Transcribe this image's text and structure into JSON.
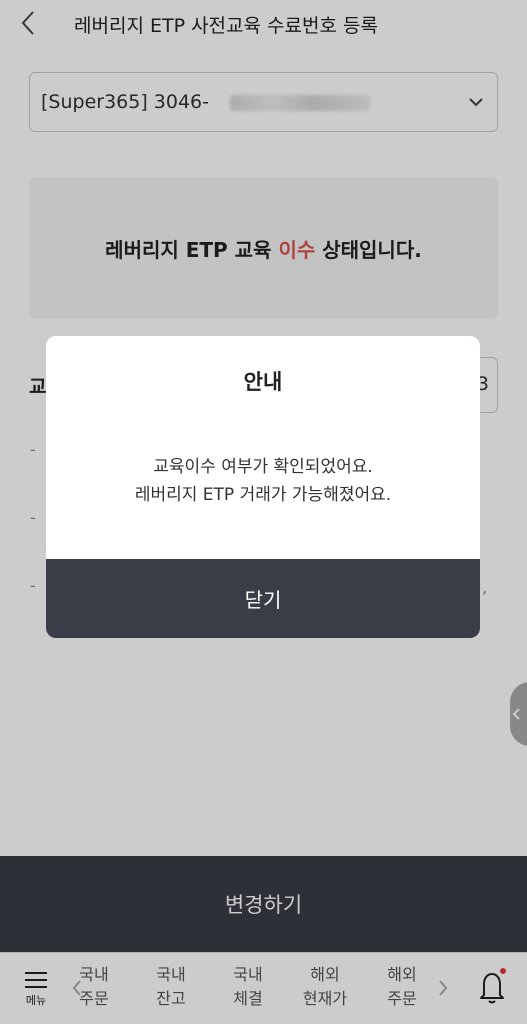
{
  "header": {
    "title": "레버리지 ETP 사전교육 수료번호 등록"
  },
  "account_select": {
    "value": "[Super365] 3046-"
  },
  "status": {
    "prefix": "레버리지 ETP 교육 ",
    "highlight": "이수",
    "suffix": " 상태입니다."
  },
  "background_field": {
    "label": "교",
    "value_tail": "3"
  },
  "dialog": {
    "title": "안내",
    "message_line1": "교육이수 여부가 확인되었어요.",
    "message_line2": "레버리지 ETP 거래가 가능해졌어요.",
    "close_label": "닫기"
  },
  "primary_button": {
    "label": "변경하기"
  },
  "bottom_nav": {
    "menu_label": "메뉴",
    "items": [
      {
        "label": "국내\n주문"
      },
      {
        "label": "국내\n잔고"
      },
      {
        "label": "국내\n체결"
      },
      {
        "label": "해외\n현재가"
      },
      {
        "label": "해외\n주문"
      }
    ]
  },
  "colors": {
    "accent_red": "#d9534f",
    "dark_button": "#3a3d47",
    "notification_dot": "#e53935"
  },
  "icons": [
    "back-arrow-icon",
    "chevron-down-icon",
    "chevron-left-icon",
    "menu-icon",
    "chevron-right-icon",
    "bell-icon"
  ]
}
